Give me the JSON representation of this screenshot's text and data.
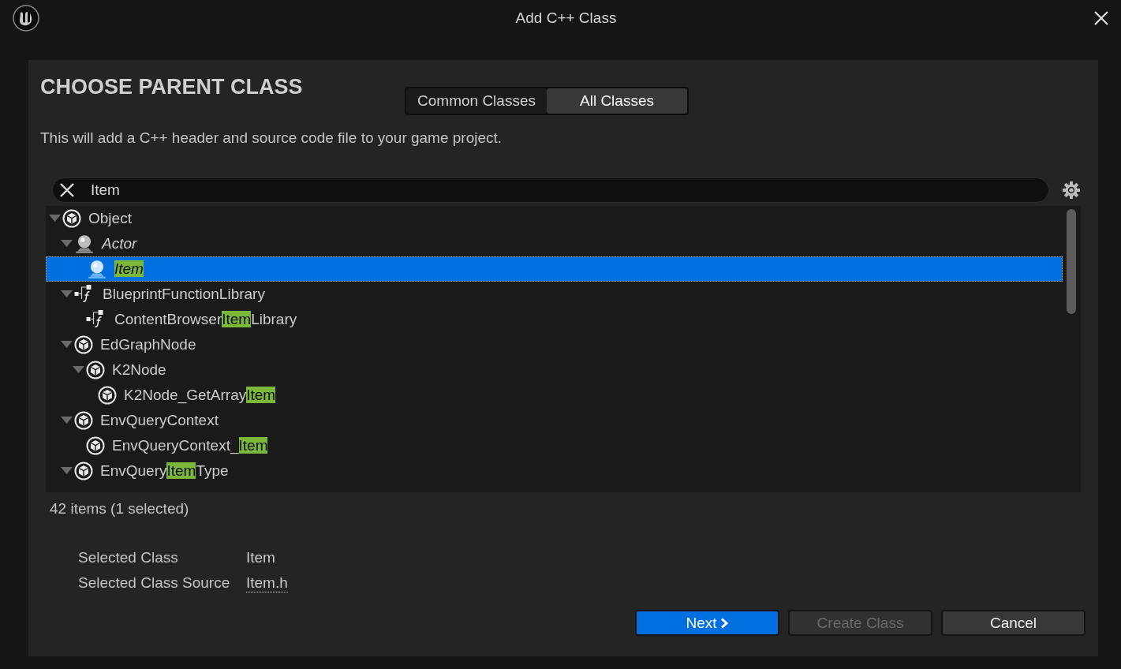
{
  "window": {
    "title": "Add C++ Class"
  },
  "heading": "CHOOSE PARENT CLASS",
  "tabs": [
    {
      "label": "Common Classes",
      "selected": false
    },
    {
      "label": "All Classes",
      "selected": true
    }
  ],
  "description": "This will add a C++ header and source code file to your game project.",
  "search": {
    "value": "Item"
  },
  "tree": [
    {
      "kind": "class",
      "italic": false,
      "expanded": true,
      "selected": false,
      "parts": [
        {
          "text": "Object",
          "match": false
        }
      ],
      "children": [
        {
          "kind": "actor",
          "italic": true,
          "expanded": true,
          "selected": false,
          "parts": [
            {
              "text": "Actor",
              "match": false
            }
          ],
          "children": [
            {
              "kind": "actor",
              "italic": true,
              "selected": true,
              "parts": [
                {
                  "text": "Item",
                  "match": true
                }
              ]
            }
          ]
        },
        {
          "kind": "function",
          "italic": false,
          "expanded": true,
          "selected": false,
          "parts": [
            {
              "text": "BlueprintFunctionLibrary",
              "match": false
            }
          ],
          "children": [
            {
              "kind": "function",
              "italic": false,
              "selected": false,
              "parts": [
                {
                  "text": "ContentBrowser",
                  "match": false
                },
                {
                  "text": "Item",
                  "match": true
                },
                {
                  "text": "Library",
                  "match": false
                }
              ]
            }
          ]
        },
        {
          "kind": "class",
          "italic": false,
          "expanded": true,
          "selected": false,
          "parts": [
            {
              "text": "EdGraphNode",
              "match": false
            }
          ],
          "children": [
            {
              "kind": "class",
              "italic": false,
              "expanded": true,
              "selected": false,
              "parts": [
                {
                  "text": "K2Node",
                  "match": false
                }
              ],
              "children": [
                {
                  "kind": "class",
                  "italic": false,
                  "selected": false,
                  "parts": [
                    {
                      "text": "K2Node_GetArray",
                      "match": false
                    },
                    {
                      "text": "Item",
                      "match": true
                    }
                  ]
                }
              ]
            }
          ]
        },
        {
          "kind": "class",
          "italic": false,
          "expanded": true,
          "selected": false,
          "parts": [
            {
              "text": "EnvQueryContext",
              "match": false
            }
          ],
          "children": [
            {
              "kind": "class",
              "italic": false,
              "selected": false,
              "parts": [
                {
                  "text": "EnvQueryContext_",
                  "match": false
                },
                {
                  "text": "Item",
                  "match": true
                }
              ]
            }
          ]
        },
        {
          "kind": "class",
          "italic": false,
          "expanded": true,
          "selected": false,
          "parts": [
            {
              "text": "EnvQuery",
              "match": false
            },
            {
              "text": "Item",
              "match": true
            },
            {
              "text": "Type",
              "match": false
            }
          ]
        }
      ]
    }
  ],
  "status": "42 items (1 selected)",
  "details": [
    {
      "label": "Selected Class",
      "value": "Item",
      "kind": "text"
    },
    {
      "label": "Selected Class Source",
      "value": "Item.h",
      "kind": "link"
    }
  ],
  "buttons": [
    {
      "label": "Next",
      "kind": "primary",
      "disabled": false,
      "chevron": true
    },
    {
      "label": "Create Class",
      "kind": "normal",
      "disabled": true,
      "chevron": false
    },
    {
      "label": "Cancel",
      "kind": "normal",
      "disabled": false,
      "chevron": false
    }
  ]
}
